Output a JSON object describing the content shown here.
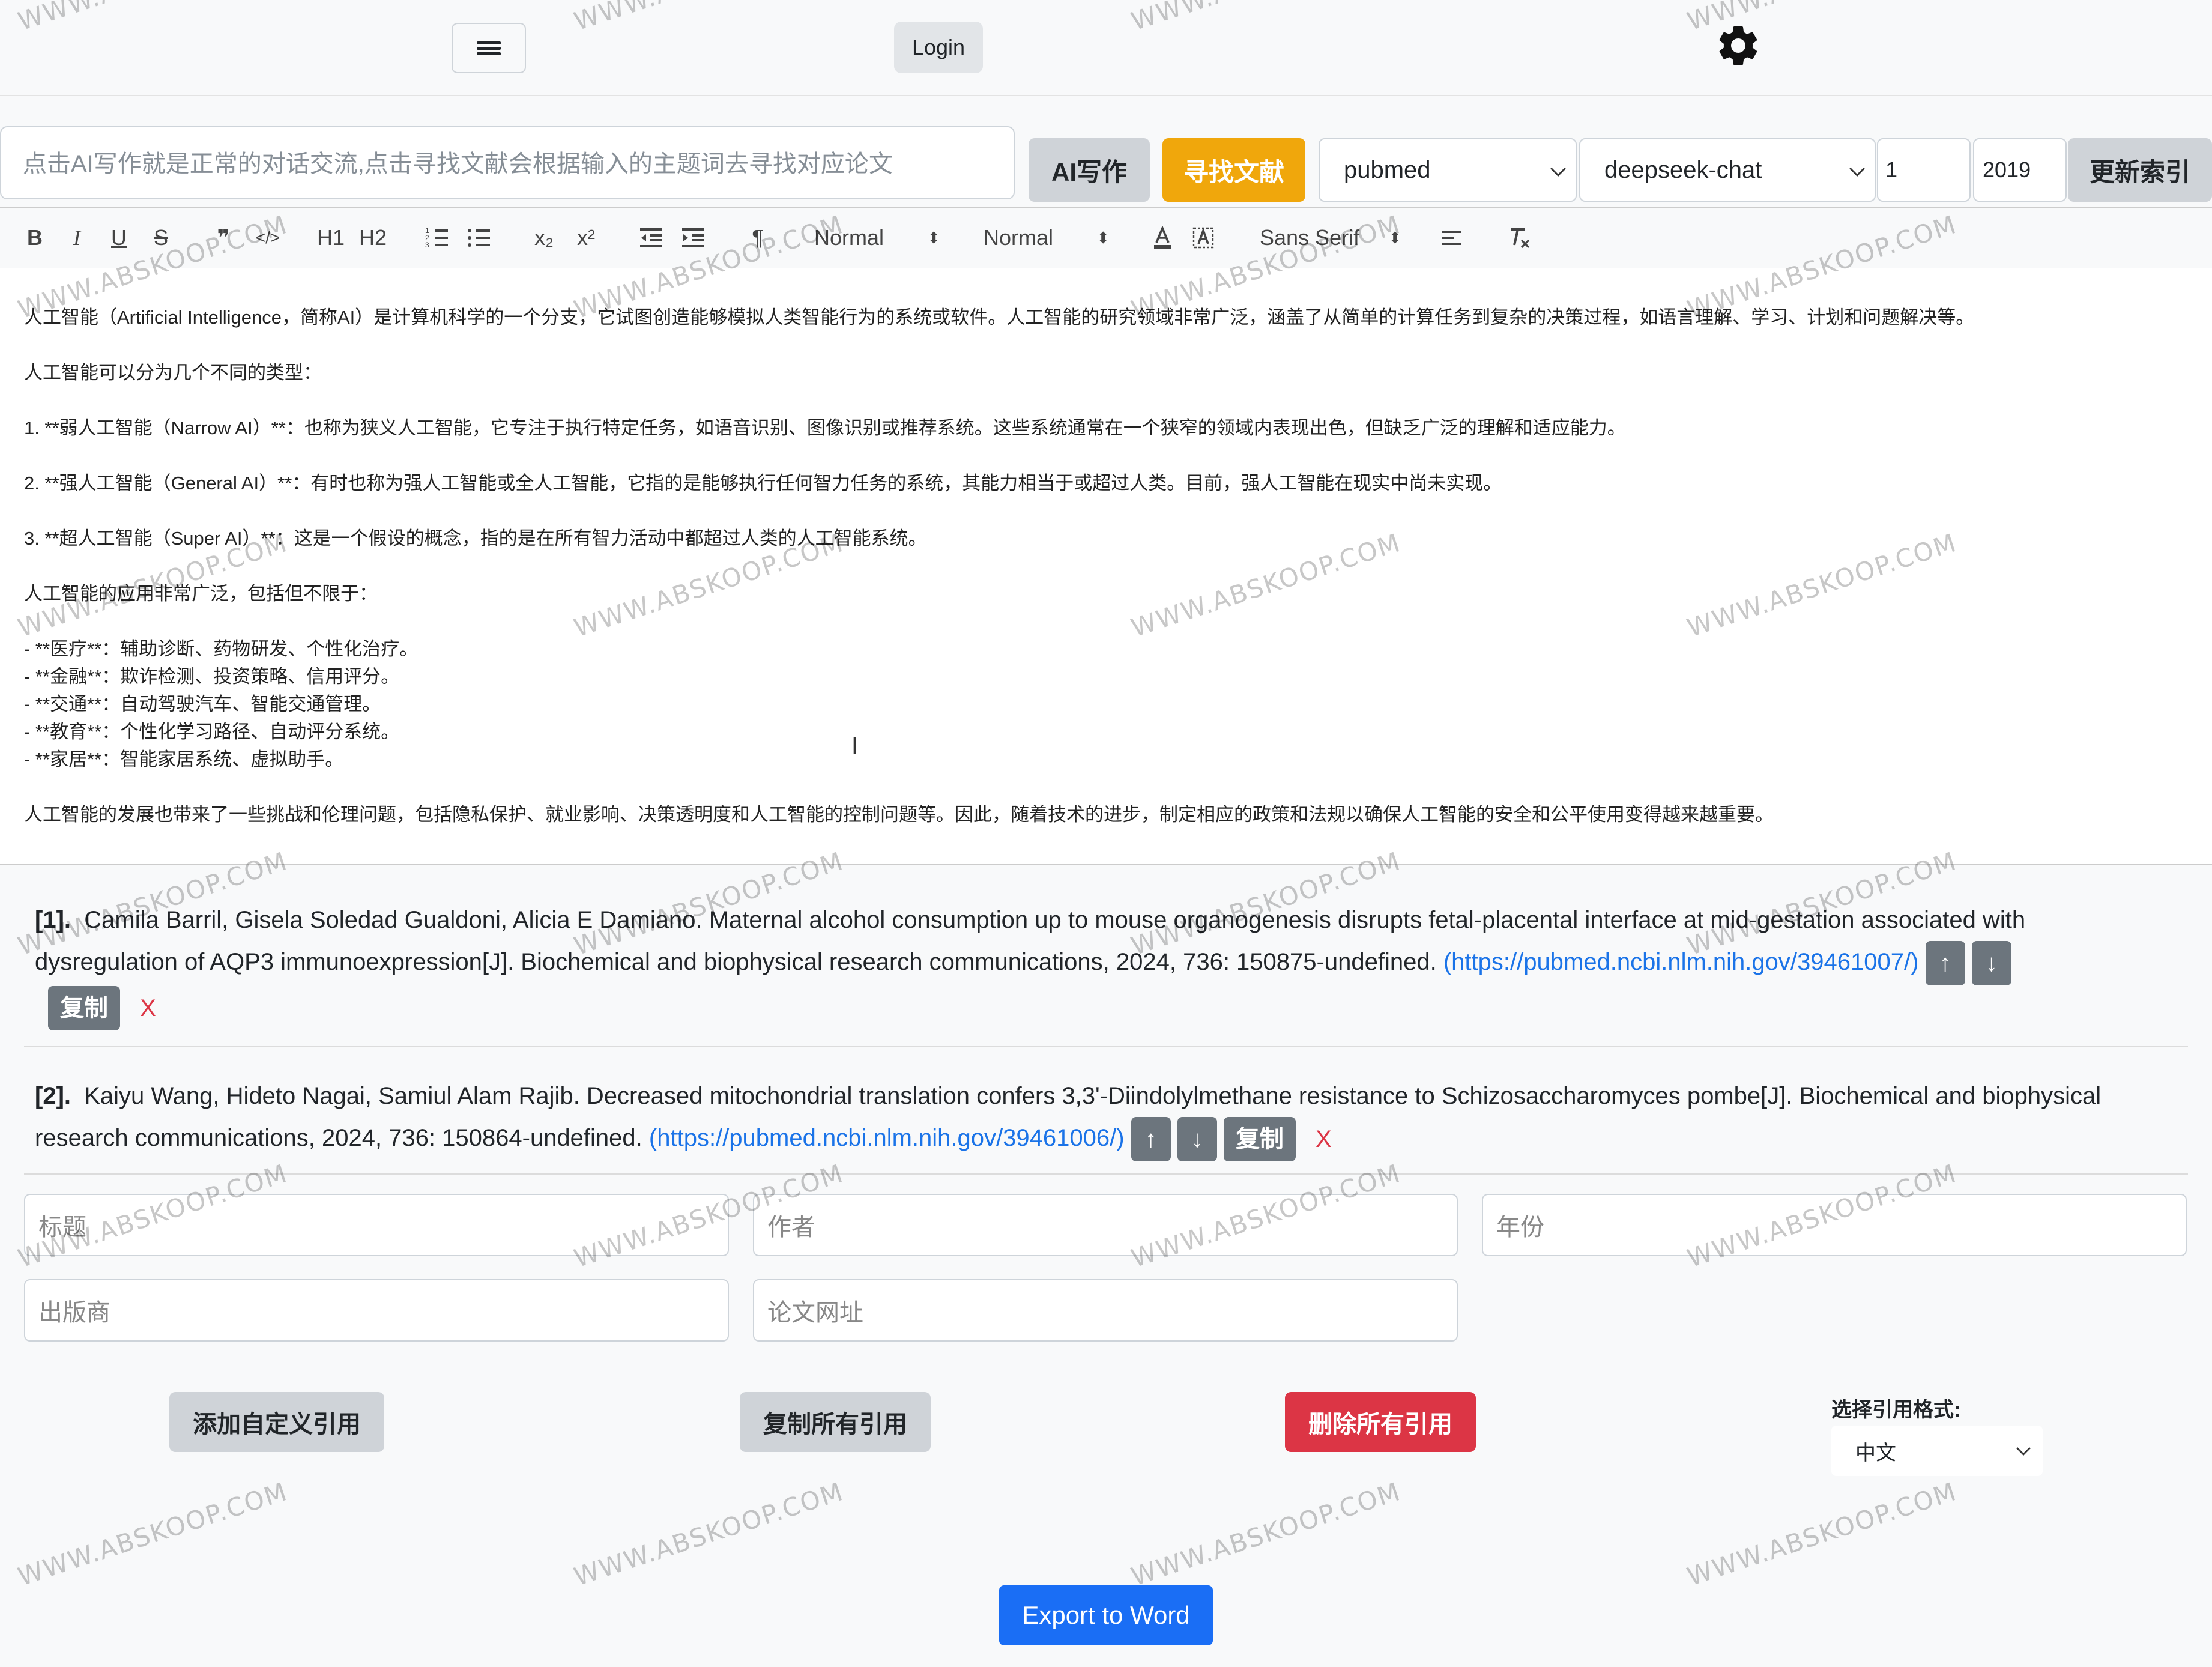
{
  "topbar": {
    "login_label": "Login"
  },
  "search": {
    "placeholder": "点击AI写作就是正常的对话交流,点击寻找文献会根据输入的主题词去寻找对应论文",
    "ai_button": "AI写作",
    "find_button": "寻找文献",
    "source_value": "pubmed",
    "model_value": "deepseek-chat",
    "count_value": "1",
    "year_value": "2019",
    "refresh_button": "更新索引"
  },
  "toolbar": {
    "bold": "B",
    "italic": "I",
    "underline": "U",
    "strike": "S",
    "quote": "❞",
    "code": "</>",
    "h1": "H1",
    "h2": "H2",
    "sub": "x₂",
    "sup": "x²",
    "rtl": "¶",
    "size_value": "Normal",
    "header_value": "Normal",
    "font_value": "Sans Serif"
  },
  "editor": {
    "lines": [
      "人工智能（Artificial Intelligence，简称AI）是计算机科学的一个分支，它试图创造能够模拟人类智能行为的系统或软件。人工智能的研究领域非常广泛，涵盖了从简单的计算任务到复杂的决策过程，如语言理解、学习、计划和问题解决等。",
      "",
      "人工智能可以分为几个不同的类型：",
      "",
      "1. **弱人工智能（Narrow AI）**：也称为狭义人工智能，它专注于执行特定任务，如语音识别、图像识别或推荐系统。这些系统通常在一个狭窄的领域内表现出色，但缺乏广泛的理解和适应能力。",
      "",
      "2. **强人工智能（General AI）**：有时也称为强人工智能或全人工智能，它指的是能够执行任何智力任务的系统，其能力相当于或超过人类。目前，强人工智能在现实中尚未实现。",
      "",
      "3. **超人工智能（Super AI）**：这是一个假设的概念，指的是在所有智力活动中都超过人类的人工智能系统。",
      "",
      "人工智能的应用非常广泛，包括但不限于：",
      "",
      "- **医疗**：辅助诊断、药物研发、个性化治疗。",
      "- **金融**：欺诈检测、投资策略、信用评分。",
      "- **交通**：自动驾驶汽车、智能交通管理。",
      "- **教育**：个性化学习路径、自动评分系统。",
      "- **家居**：智能家居系统、虚拟助手。",
      "",
      "人工智能的发展也带来了一些挑战和伦理问题，包括隐私保护、就业影响、决策透明度和人工智能的控制问题等。因此，随着技术的进步，制定相应的政策和法规以确保人工智能的安全和公平使用变得越来越重要。"
    ]
  },
  "references": [
    {
      "index": "[1].",
      "text": "Camila Barril, Gisela Soledad Gualdoni, Alicia E Damiano. Maternal alcohol consumption up to mouse organogenesis disrupts fetal-placental interface at mid-gestation associated with dysregulation of AQP3 immunoexpression[J]. Biochemical and biophysical research communications, 2024, 736: 150875-undefined.",
      "link": "(https://pubmed.ncbi.nlm.nih.gov/39461007/)"
    },
    {
      "index": "[2].",
      "text": "Kaiyu Wang, Hideto Nagai, Samiul Alam Rajib. Decreased mitochondrial translation confers 3,3'-Diindolylmethane resistance to Schizosaccharomyces pombe[J]. Biochemical and biophysical research communications, 2024, 736: 150864-undefined.",
      "link": "(https://pubmed.ncbi.nlm.nih.gov/39461006/)"
    }
  ],
  "ref_controls": {
    "up": "↑",
    "down": "↓",
    "copy": "复制",
    "delete": "X"
  },
  "custom_fields": {
    "title_placeholder": "标题",
    "author_placeholder": "作者",
    "year_placeholder": "年份",
    "publisher_placeholder": "出版商",
    "url_placeholder": "论文网址"
  },
  "actions": {
    "add_custom": "添加自定义引用",
    "copy_all": "复制所有引用",
    "delete_all": "删除所有引用",
    "format_label": "选择引用格式:",
    "format_value": "中文",
    "export": "Export to Word"
  },
  "watermark": "WWW.ABSKOOP.COM",
  "colors": {
    "find_button": "#f0a70c",
    "delete_all": "#dc3545",
    "export": "#1a6ef5",
    "link": "#1a73e8"
  }
}
